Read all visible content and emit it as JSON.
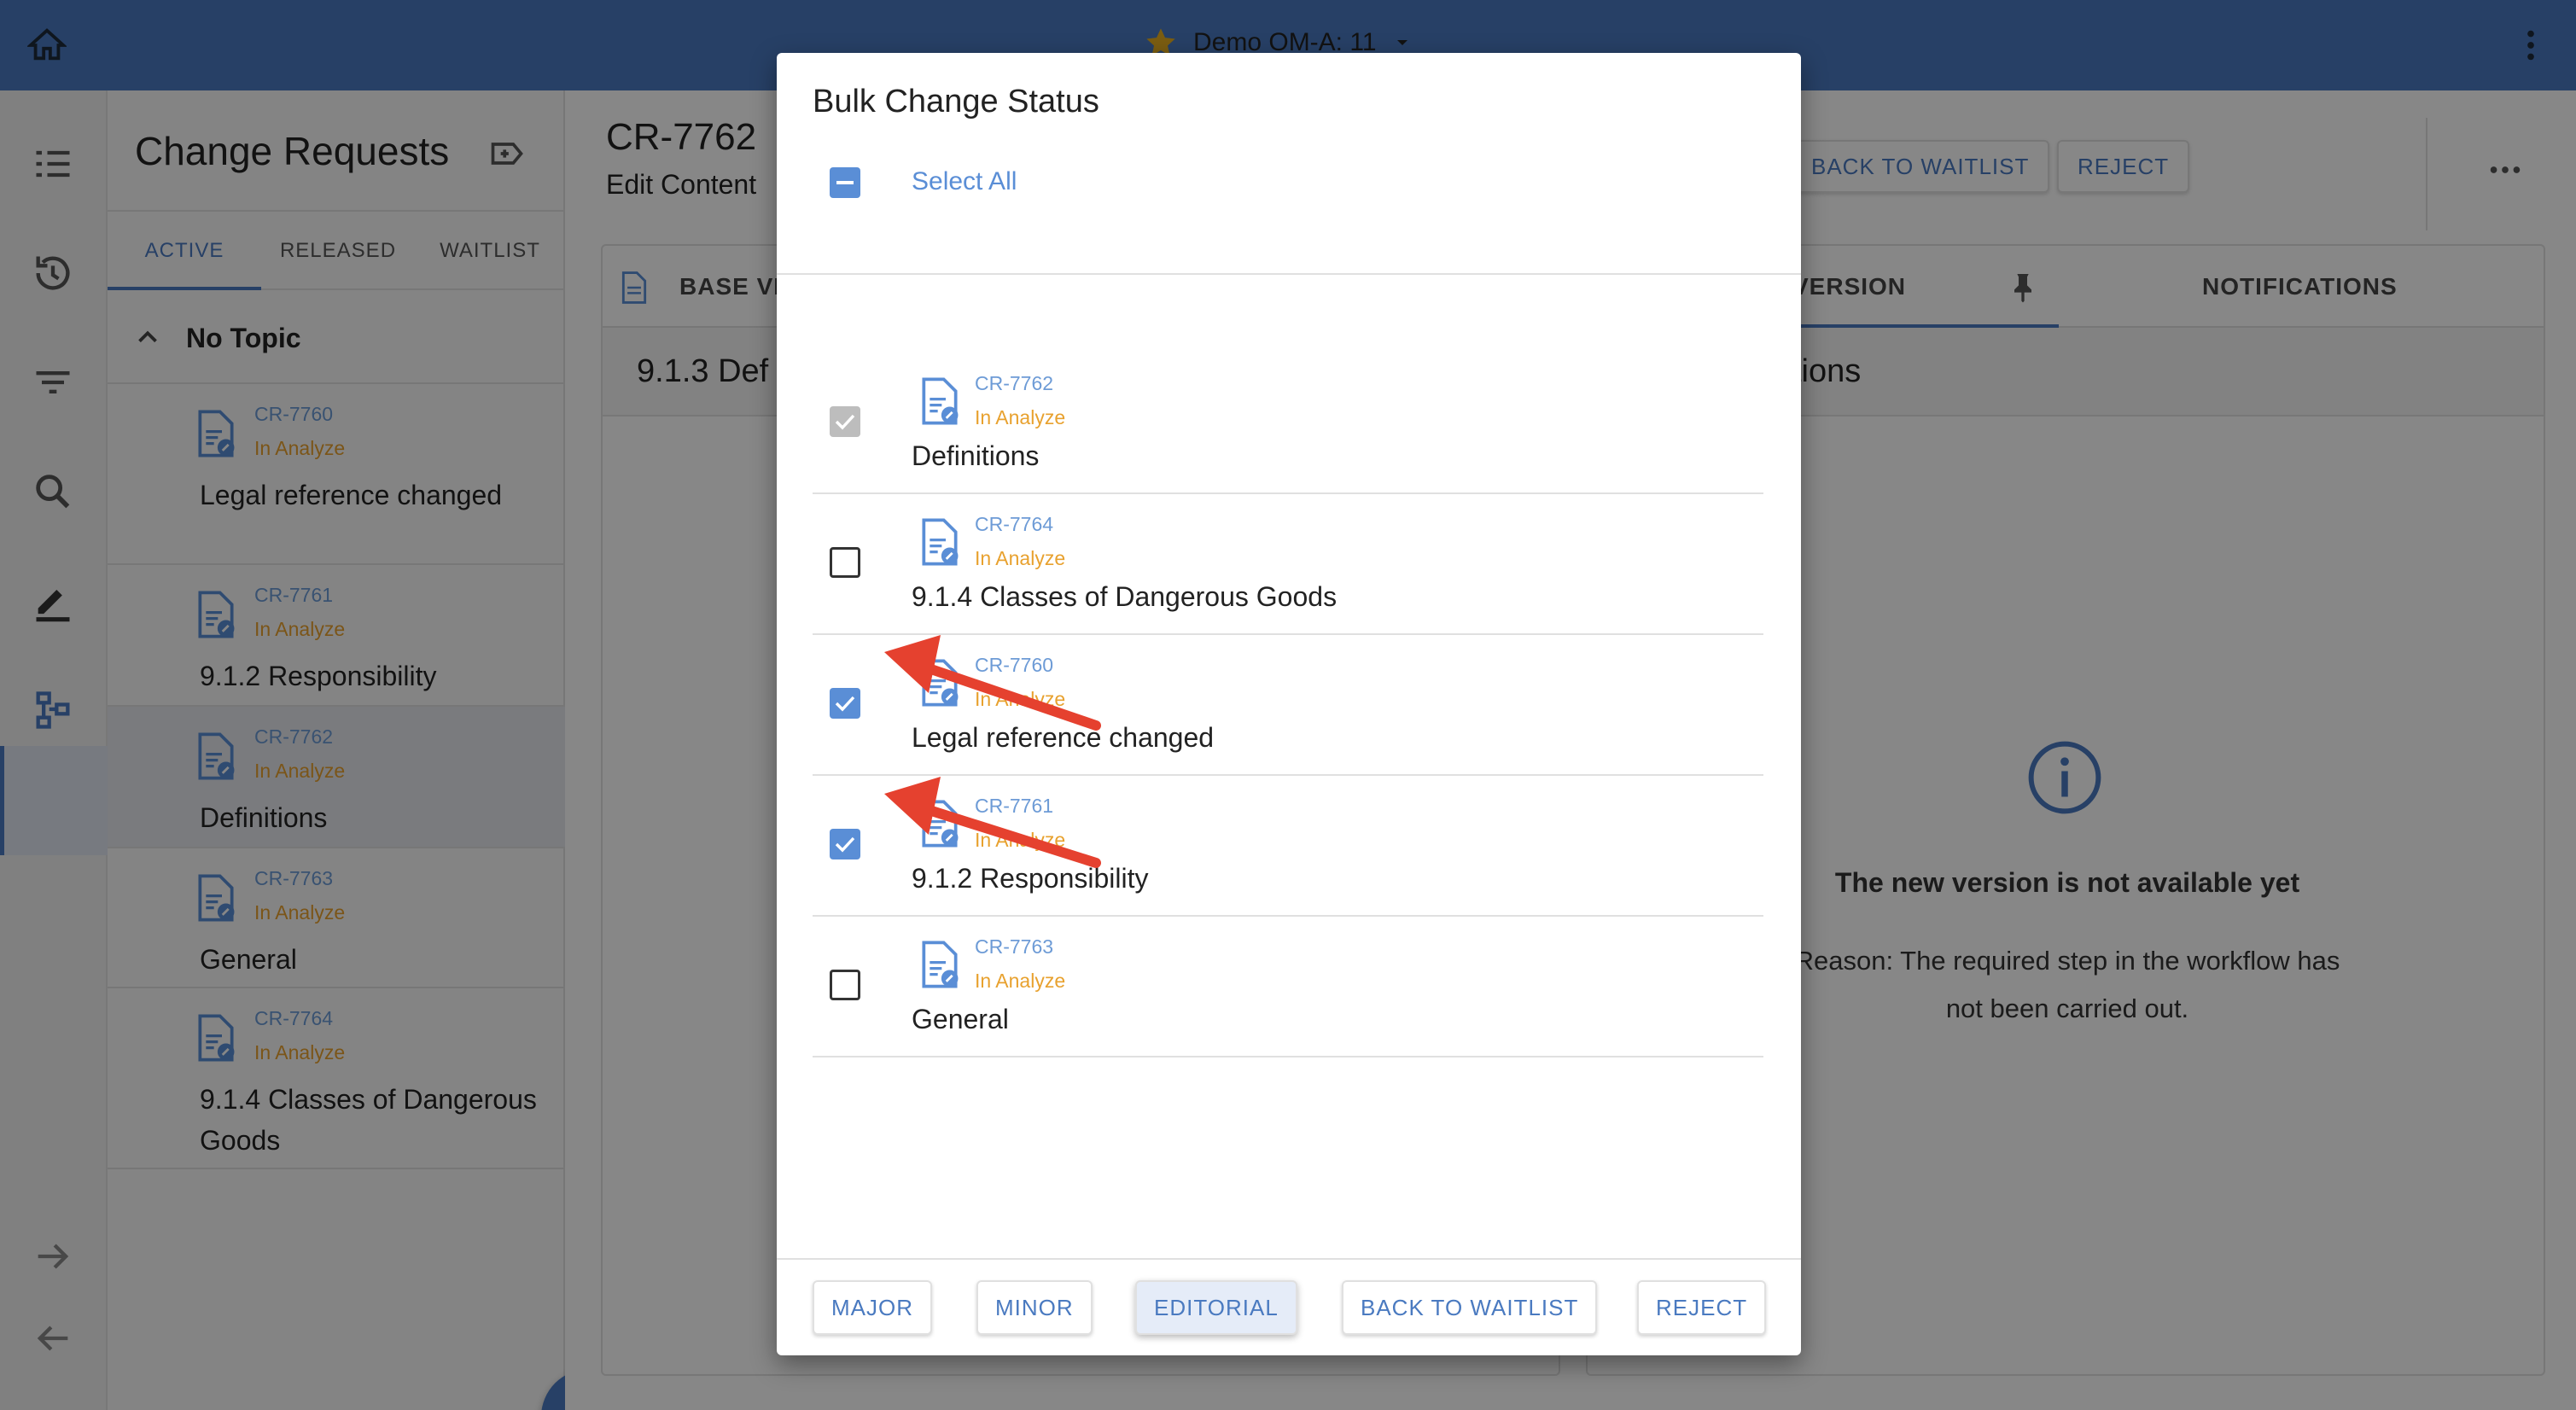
{
  "topbar": {
    "title": "Demo OM-A: 11"
  },
  "sidebar": {
    "title": "Change Requests",
    "tabs": [
      "ACTIVE",
      "RELEASED",
      "WAITLIST"
    ],
    "group": "No Topic",
    "items": [
      {
        "id": "CR-7760",
        "status": "In Analyze",
        "name": "Legal reference changed"
      },
      {
        "id": "CR-7761",
        "status": "In Analyze",
        "name": "9.1.2 Responsibility"
      },
      {
        "id": "CR-7762",
        "status": "In Analyze",
        "name": "Definitions"
      },
      {
        "id": "CR-7763",
        "status": "In Analyze",
        "name": "General"
      },
      {
        "id": "CR-7764",
        "status": "In Analyze",
        "name": "9.1.4 Classes of Dangerous Goods"
      }
    ]
  },
  "main": {
    "cr_id": "CR-7762",
    "cr_subtitle": "Edit Content",
    "back_to_waitlist": "BACK TO WAITLIST",
    "reject": "REJECT",
    "base_tab": "BASE VE",
    "version_tab": "VERSION",
    "notifications_tab": "NOTIFICATIONS",
    "section_left": "9.1.3 Def",
    "section_right": "tions",
    "info_title": "The new version is not available yet",
    "info_text": "Reason: The required step in the workflow has not been carried out."
  },
  "dialog": {
    "title": "Bulk Change Status",
    "select_all": "Select All",
    "rows": [
      {
        "id": "CR-7762",
        "status": "In Analyze",
        "name": "Definitions",
        "state": "disabled-checked"
      },
      {
        "id": "CR-7764",
        "status": "In Analyze",
        "name": "9.1.4 Classes of Dangerous Goods",
        "state": "unchecked"
      },
      {
        "id": "CR-7760",
        "status": "In Analyze",
        "name": "Legal reference changed",
        "state": "checked"
      },
      {
        "id": "CR-7761",
        "status": "In Analyze",
        "name": "9.1.2 Responsibility",
        "state": "checked"
      },
      {
        "id": "CR-7763",
        "status": "In Analyze",
        "name": "General",
        "state": "unchecked"
      }
    ],
    "buttons": [
      "MAJOR",
      "MINOR",
      "EDITORIAL",
      "BACK TO WAITLIST",
      "REJECT"
    ]
  },
  "colors": {
    "accent": "#4a7ac0",
    "status": "#e8a12e",
    "annotation": "#e5412f"
  },
  "icons": [
    "home-icon",
    "star-icon",
    "chevron-down-icon",
    "more-vertical-icon",
    "list-icon",
    "history-icon",
    "filter-icon",
    "search-icon",
    "edit-icon",
    "workflow-icon",
    "arrow-right-icon",
    "arrow-left-icon",
    "document-icon",
    "pin-icon",
    "info-icon"
  ]
}
